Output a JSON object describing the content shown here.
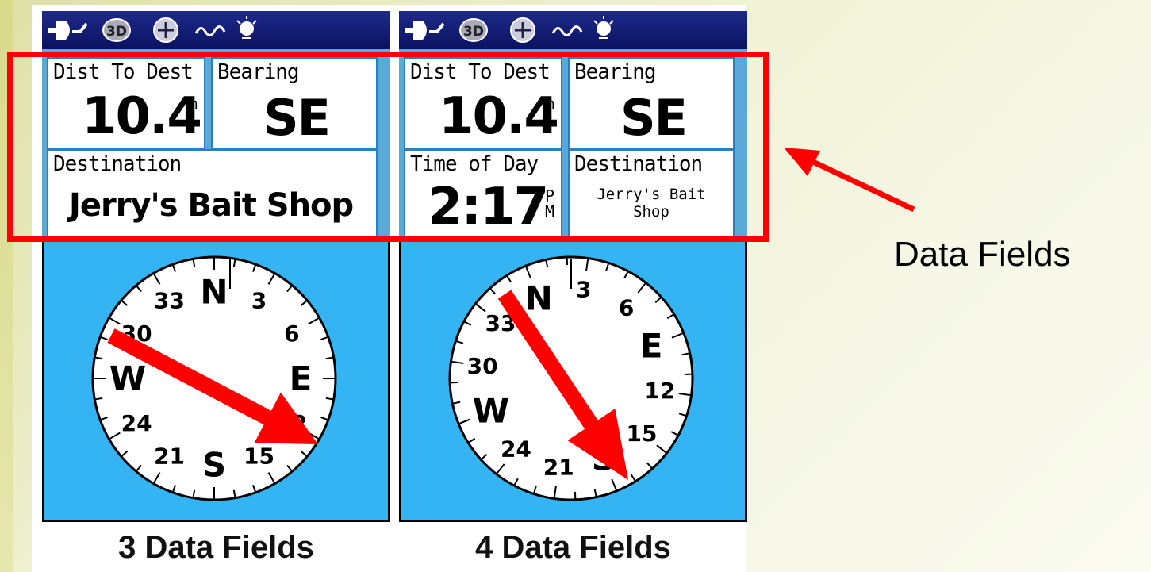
{
  "device_left": {
    "status_icons": [
      "power-plug-icon",
      "3d-fix-icon",
      "satellite-icon",
      "signal-wave-icon",
      "backlight-icon"
    ],
    "status_badge": "3D",
    "fields": [
      {
        "label": "Dist To Dest",
        "value": "10.4",
        "unit_top": "m",
        "unit_bottom": "i"
      },
      {
        "label": "Bearing",
        "value": "SE"
      },
      {
        "label": "Destination",
        "value": "Jerry's Bait Shop"
      }
    ],
    "compass": {
      "labels": [
        "N",
        "3",
        "6",
        "E",
        "12",
        "15",
        "S",
        "21",
        "24",
        "W",
        "30",
        "33"
      ],
      "pointer": "arrow-icon",
      "pointer_color": "#ff0000"
    },
    "caption": "3 Data Fields"
  },
  "device_right": {
    "status_icons": [
      "power-plug-icon",
      "3d-fix-icon",
      "satellite-icon",
      "signal-wave-icon",
      "backlight-icon"
    ],
    "status_badge": "3D",
    "fields": [
      {
        "label": "Dist To Dest",
        "value": "10.4",
        "unit_top": "m",
        "unit_bottom": "i"
      },
      {
        "label": "Bearing",
        "value": "SE"
      },
      {
        "label": "Time of Day",
        "value": "2:17",
        "unit_top": "P",
        "unit_bottom": "M"
      },
      {
        "label": "Destination",
        "value_line1": "Jerry's Bait",
        "value_line2": "Shop"
      }
    ],
    "compass": {
      "labels": [
        "N",
        "3",
        "6",
        "E",
        "12",
        "15",
        "S",
        "21",
        "24",
        "W",
        "30",
        "33"
      ],
      "pointer": "arrow-icon",
      "pointer_color": "#ff0000"
    },
    "caption": "4 Data Fields"
  },
  "annotation": {
    "label": "Data Fields",
    "highlight_color": "#ff0000"
  },
  "colors": {
    "field_background": "#ffffff",
    "field_border": "#2b7fc0",
    "compass_background": "#34b4f2",
    "status_bar": "#1e2a8a"
  }
}
